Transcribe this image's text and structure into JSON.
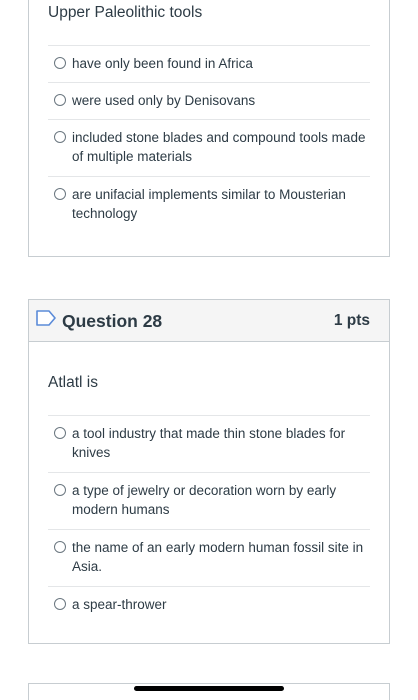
{
  "previous_question": {
    "text": "Upper Paleolithic tools",
    "answers": [
      {
        "label": "have only been found in Africa"
      },
      {
        "label": "were used only by Denisovans"
      },
      {
        "label": "included stone blades and compound tools made of multiple materials"
      },
      {
        "label": "are unifacial implements similar to Mousterian technology"
      }
    ]
  },
  "question_28": {
    "title": "Question 28",
    "points": "1 pts",
    "text": "Atlatl is",
    "answers": [
      {
        "label": "a tool industry that made thin stone blades for knives"
      },
      {
        "label": "a type of jewelry or decoration worn by early modern humans"
      },
      {
        "label": "the name of an early modern human fossil site in Asia."
      },
      {
        "label": "a spear-thrower"
      }
    ]
  },
  "colors": {
    "text": "#2d3b45",
    "border": "#c7cdd1",
    "header_bg": "#f5f5f5",
    "flag_outline": "#5b8bd8"
  },
  "icons": {
    "flag": "bookmark-flag-icon",
    "radio": "radio-unselected-icon"
  }
}
